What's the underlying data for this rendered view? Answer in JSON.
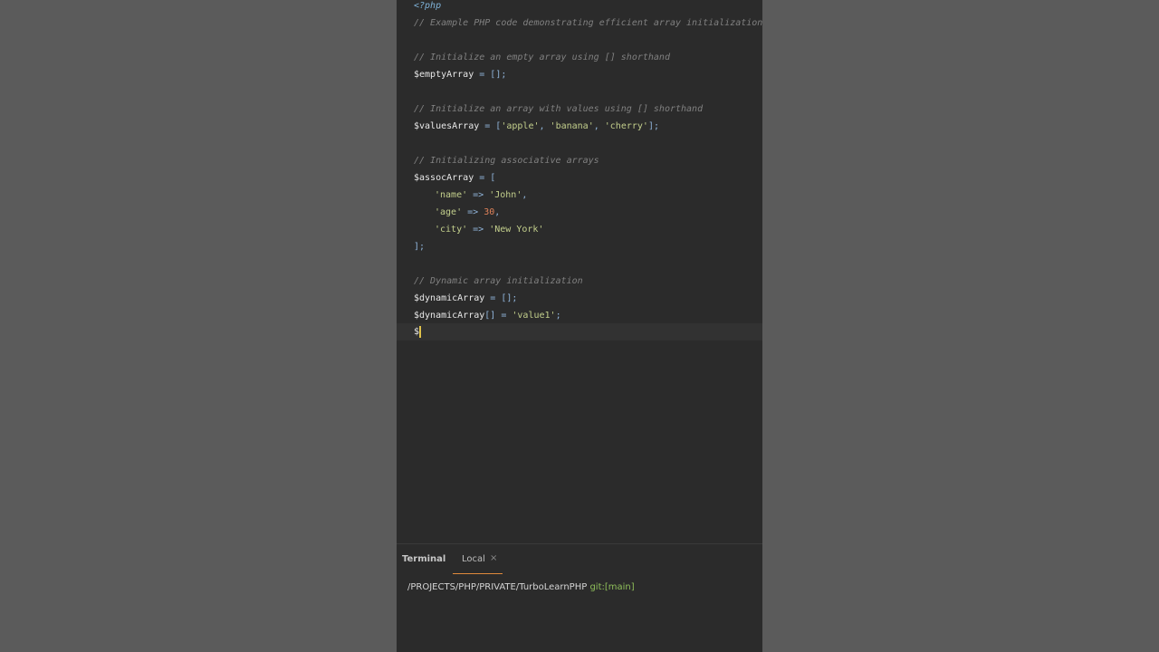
{
  "editor": {
    "lines": [
      {
        "tag": "<?php"
      },
      {
        "comment": "// Example PHP code demonstrating efficient array initialization"
      },
      {},
      {
        "comment": "// Initialize an empty array using [] shorthand"
      },
      {
        "var": "$emptyArray",
        "rest": " = [];"
      },
      {},
      {
        "comment": "// Initialize an array with values using [] shorthand"
      },
      {
        "var": "$valuesArray",
        "rest1": " = [",
        "s1": "'apple'",
        "c1": ", ",
        "s2": "'banana'",
        "c2": ", ",
        "s3": "'cherry'",
        "rest2": "];"
      },
      {},
      {
        "comment": "// Initializing associative arrays"
      },
      {
        "var": "$assocArray",
        "rest": " = ["
      },
      {
        "k": "'name'",
        "op": " => ",
        "v": "'John'",
        "end": ","
      },
      {
        "k": "'age'",
        "op": " => ",
        "n": "30",
        "end": ","
      },
      {
        "k": "'city'",
        "op": " => ",
        "v": "'New York'",
        "end": ""
      },
      {
        "rest": "];"
      },
      {},
      {
        "comment": "// Dynamic array initialization"
      },
      {
        "var": "$dynamicArray",
        "rest": " = [];"
      },
      {
        "var": "$dynamicArray",
        "rest1": "[] = ",
        "s1": "'value1'",
        "rest2": ";"
      },
      {
        "var": "$"
      }
    ]
  },
  "terminal": {
    "title": "Terminal",
    "tab_label": "Local",
    "tab_close": "×",
    "path": "/PROJECTS/PHP/PRIVATE/TurboLearnPHP ",
    "git": "git:[main]"
  },
  "colors": {
    "editor_bg": "#2b2b2b",
    "page_bg": "#5b5b5b",
    "tab_accent": "#e08a3c",
    "git_green": "#8fbf5a"
  }
}
